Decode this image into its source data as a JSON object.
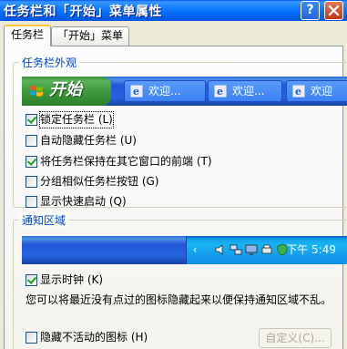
{
  "window": {
    "title": "任务栏和「开始」菜单属性",
    "help_label": "?"
  },
  "tabs": [
    {
      "label": "任务栏",
      "active": true
    },
    {
      "label": "「开始」菜单",
      "active": false
    }
  ],
  "taskbar_group": {
    "title": "任务栏外观",
    "preview": {
      "start_label": "开始",
      "buttons": [
        {
          "label": "欢迎...",
          "icon": "ie-icon"
        },
        {
          "label": "欢迎...",
          "icon": "ie-icon"
        },
        {
          "label": "欢迎",
          "icon": "ie-icon"
        }
      ]
    },
    "options": [
      {
        "label": "锁定任务栏 (L)",
        "checked": true
      },
      {
        "label": "自动隐藏任务栏 (U)",
        "checked": false
      },
      {
        "label": "将任务栏保持在其它窗口的前端 (T)",
        "checked": true
      },
      {
        "label": "分组相似任务栏按钮 (G)",
        "checked": false
      },
      {
        "label": "显示快速启动 (Q)",
        "checked": false
      }
    ]
  },
  "notify_group": {
    "title": "通知区域",
    "preview": {
      "time": "下午 5:49",
      "icons": [
        "chevron-left-icon",
        "speaker-icon",
        "network-icon",
        "monitor-icon",
        "printer-icon",
        "shield-icon"
      ]
    },
    "show_clock": {
      "label": "显示时钟 (K)",
      "checked": true
    },
    "description": "您可以将最近没有点过的图标隐藏起来以便保持通知区域不乱。",
    "hide_inactive": {
      "label": "隐藏不活动的图标 (H)",
      "checked": false
    },
    "customize_label": "自定义(C)..."
  },
  "colors": {
    "titlebar": "#0058EE",
    "group_title": "#0046D5",
    "tab_highlight": "#FFC73C"
  }
}
